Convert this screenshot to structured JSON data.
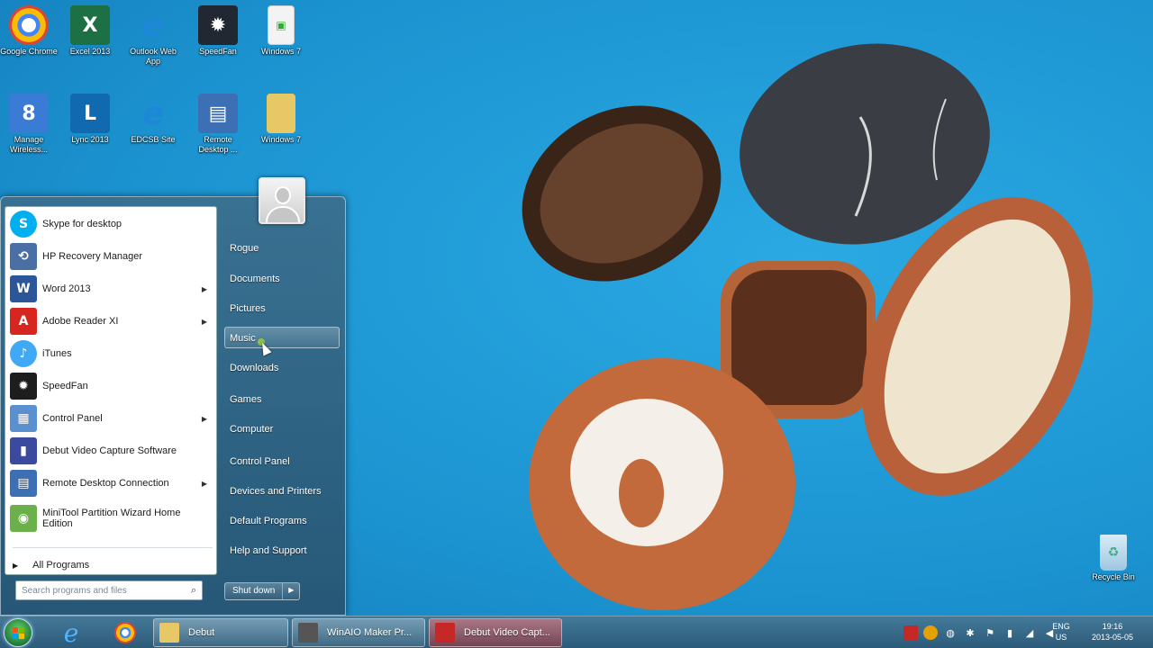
{
  "desktop": {
    "icons": [
      {
        "label": "Google Chrome",
        "icon": "chrome-icon",
        "color": "#db4437"
      },
      {
        "label": "Excel 2013",
        "icon": "excel-icon",
        "color": "#1d7044"
      },
      {
        "label": "Outlook Web App",
        "icon": "ie-icon",
        "color": "#1e88d8"
      },
      {
        "label": "SpeedFan",
        "icon": "speedfan-icon",
        "color": "#222831"
      },
      {
        "label": "Windows 7",
        "icon": "document-icon",
        "color": "#f3f3f3"
      },
      {
        "label": "Manage Wireless...",
        "icon": "wireless-icon",
        "color": "#3a7bd5"
      },
      {
        "label": "Lync 2013",
        "icon": "lync-icon",
        "color": "#1169b0"
      },
      {
        "label": "EDCSB Site",
        "icon": "ie-icon",
        "color": "#1e88d8"
      },
      {
        "label": "Remote Desktop ...",
        "icon": "remote-desktop-icon",
        "color": "#3d6fb5"
      },
      {
        "label": "Windows 7",
        "icon": "folder-icon",
        "color": "#e8c766"
      }
    ],
    "recycle_bin": "Recycle Bin"
  },
  "start_menu": {
    "programs": [
      {
        "label": "Skype for desktop",
        "icon": "skype-icon",
        "color": "#00aff0",
        "submenu": false
      },
      {
        "label": "HP Recovery Manager",
        "icon": "hp-recovery-icon",
        "color": "#4a6fa5",
        "submenu": false
      },
      {
        "label": "Word 2013",
        "icon": "word-icon",
        "color": "#2b579a",
        "submenu": true
      },
      {
        "label": "Adobe Reader XI",
        "icon": "adobe-reader-icon",
        "color": "#d7261f",
        "submenu": true
      },
      {
        "label": "iTunes",
        "icon": "itunes-icon",
        "color": "#3fa9f5",
        "submenu": false
      },
      {
        "label": "SpeedFan",
        "icon": "speedfan-icon",
        "color": "#1d1d1d",
        "submenu": false
      },
      {
        "label": "Control Panel",
        "icon": "control-panel-icon",
        "color": "#5a8fd0",
        "submenu": true
      },
      {
        "label": "Debut Video Capture Software",
        "icon": "debut-icon",
        "color": "#3b4a9e",
        "submenu": false
      },
      {
        "label": "Remote Desktop Connection",
        "icon": "remote-desktop-icon",
        "color": "#3d6fb5",
        "submenu": true
      },
      {
        "label": "MiniTool Partition Wizard Home Edition",
        "icon": "minitool-icon",
        "color": "#6bb04a",
        "submenu": false
      }
    ],
    "all_programs": "All Programs",
    "search_placeholder": "Search programs and files",
    "user_name": "Rogue",
    "places": [
      "Rogue",
      "Documents",
      "Pictures",
      "Music",
      "Downloads",
      "Games",
      "Computer",
      "Control Panel",
      "Devices and Printers",
      "Default Programs",
      "Help and Support"
    ],
    "highlighted": "Music",
    "shutdown_label": "Shut down"
  },
  "taskbar": {
    "pinned": [
      {
        "name": "ie",
        "icon": "ie-icon"
      },
      {
        "name": "chrome",
        "icon": "chrome-icon"
      }
    ],
    "tasks": [
      {
        "label": "Debut",
        "icon": "folder-icon",
        "color": "#e8c766",
        "active": false
      },
      {
        "label": "WinAIO Maker Pr...",
        "icon": "winaio-icon",
        "color": "#555555",
        "active": false
      },
      {
        "label": "Debut Video Capt...",
        "icon": "debut-icon",
        "color": "#c62828",
        "active": true
      }
    ],
    "language": {
      "code": "ENG",
      "region": "US"
    },
    "time": "19:16",
    "date": "2013-05-05"
  }
}
